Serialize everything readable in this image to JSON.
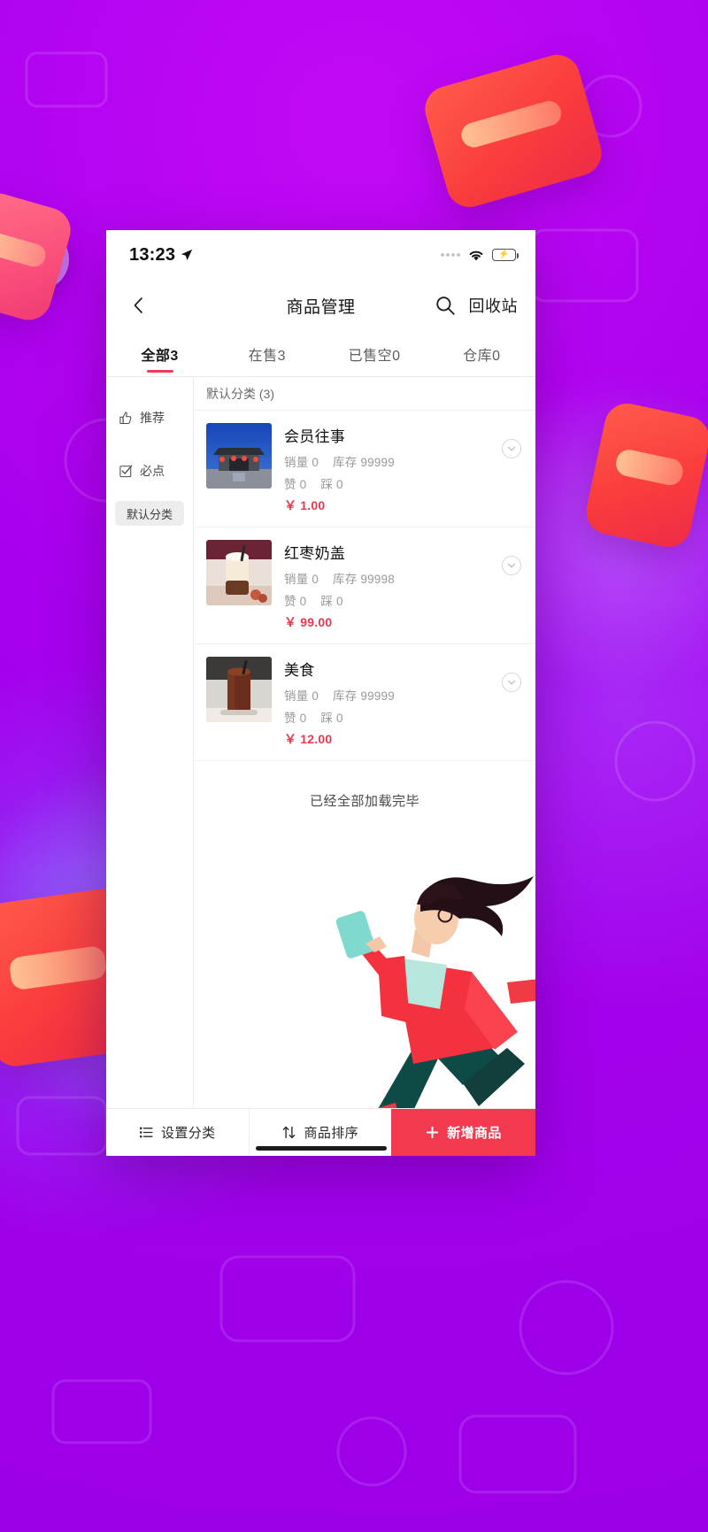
{
  "status_bar": {
    "time": "13:23",
    "location_icon": "location-arrow-icon",
    "signal_icon": "signal-dots-icon",
    "wifi_icon": "wifi-icon",
    "battery_icon": "battery-charging-icon",
    "battery_level_percent": 78
  },
  "navbar": {
    "back_icon": "chevron-left-icon",
    "title": "商品管理",
    "search_icon": "search-icon",
    "recycle_label": "回收站"
  },
  "tabs": [
    {
      "label": "全部3",
      "active": true
    },
    {
      "label": "在售3",
      "active": false
    },
    {
      "label": "已售空0",
      "active": false
    },
    {
      "label": "仓库0",
      "active": false
    }
  ],
  "sidebar": {
    "items": [
      {
        "label": "推荐",
        "icon": "thumbs-up-icon"
      },
      {
        "label": "必点",
        "icon": "checkbox-checked-icon"
      }
    ],
    "category_selected": "默认分类"
  },
  "list": {
    "category_header": "默认分类 (3)",
    "load_end_text": "已经全部加载完毕",
    "labels": {
      "sales": "销量",
      "stock": "库存",
      "like": "赞",
      "dislike": "踩",
      "currency": "￥"
    },
    "products": [
      {
        "name": "会员往事",
        "sales_label": "销量 0",
        "stock_label": "库存 99999",
        "like_label": "赞 0",
        "dislike_label": "踩 0",
        "price": "￥ 1.00",
        "thumb": "temple-night-photo",
        "expand_icon": "chevron-down-circle-icon"
      },
      {
        "name": "红枣奶盖",
        "sales_label": "销量 0",
        "stock_label": "库存 99998",
        "like_label": "赞 0",
        "dislike_label": "踩 0",
        "price": "￥ 99.00",
        "thumb": "milk-tea-photo",
        "expand_icon": "chevron-down-circle-icon"
      },
      {
        "name": "美食",
        "sales_label": "销量 0",
        "stock_label": "库存 99999",
        "like_label": "赞 0",
        "dislike_label": "踩 0",
        "price": "￥ 12.00",
        "thumb": "iced-drink-photo",
        "expand_icon": "chevron-down-circle-icon"
      }
    ]
  },
  "footer": {
    "set_category": {
      "label": "设置分类",
      "icon": "list-icon"
    },
    "sort_products": {
      "label": "商品排序",
      "icon": "sort-arrows-icon"
    },
    "add_product": {
      "label": "新增商品",
      "icon": "plus-icon"
    }
  },
  "colors": {
    "background_purple": "#a800f0",
    "accent_red": "#f2394f",
    "price_red": "#e8384f",
    "tab_indicator": "#f2395a",
    "battery_green": "#3ddc5b"
  }
}
